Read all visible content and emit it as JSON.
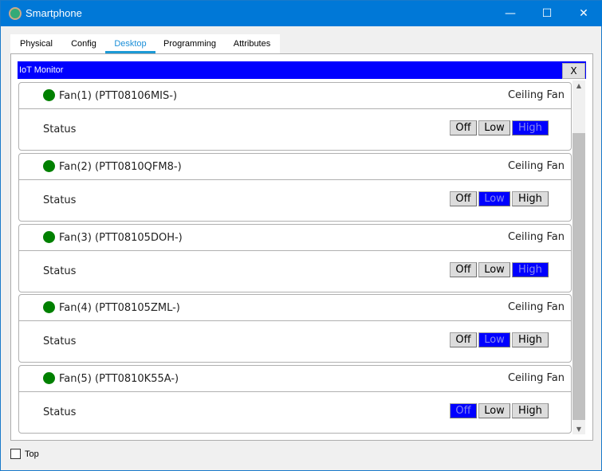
{
  "window": {
    "title": "Smartphone",
    "minimize": "—",
    "maximize": "☐",
    "close": "✕"
  },
  "tabs": [
    {
      "label": "Physical"
    },
    {
      "label": "Config"
    },
    {
      "label": "Desktop",
      "active": true
    },
    {
      "label": "Programming"
    },
    {
      "label": "Attributes"
    }
  ],
  "iot_monitor": {
    "title": "IoT Monitor",
    "close_label": "X"
  },
  "devices": [
    {
      "name": "Fan(1) (PTT08106MIS-)",
      "type": "Ceiling Fan",
      "status_label": "Status",
      "state": "High"
    },
    {
      "name": "Fan(2) (PTT0810QFM8-)",
      "type": "Ceiling Fan",
      "status_label": "Status",
      "state": "Low"
    },
    {
      "name": "Fan(3) (PTT08105DOH-)",
      "type": "Ceiling Fan",
      "status_label": "Status",
      "state": "High"
    },
    {
      "name": "Fan(4) (PTT08105ZML-)",
      "type": "Ceiling Fan",
      "status_label": "Status",
      "state": "Low"
    },
    {
      "name": "Fan(5) (PTT0810K55A-)",
      "type": "Ceiling Fan",
      "status_label": "Status",
      "state": "Off"
    }
  ],
  "options": [
    "Off",
    "Low",
    "High"
  ],
  "footer": {
    "top_label": "Top",
    "top_checked": false
  },
  "colors": {
    "titlebar": "#0078d7",
    "header": "#0000ff",
    "online": "#008000"
  }
}
